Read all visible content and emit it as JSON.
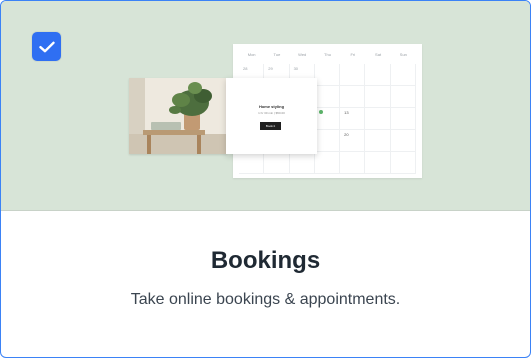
{
  "card": {
    "selected": true,
    "title": "Bookings",
    "description": "Take online bookings & appointments."
  },
  "illustration": {
    "weekdays": [
      "Mon",
      "Tue",
      "Wed",
      "Thu",
      "Fri",
      "Sat",
      "Sun"
    ],
    "days": [
      "28",
      "29",
      "30",
      "",
      "",
      "",
      "",
      "",
      "",
      "",
      "",
      "",
      "",
      "",
      "",
      "",
      "",
      "",
      "13",
      "",
      "",
      "",
      "",
      "",
      "",
      "20",
      "",
      "",
      "",
      "",
      "",
      "",
      "",
      "",
      ""
    ],
    "popup_title": "Home styling",
    "popup_detail": "1 hr 30 min | $50.00",
    "popup_button": "Book it"
  },
  "colors": {
    "accent": "#2f6ff2",
    "border": "#3b82f6",
    "hero_bg": "#d7e4d7"
  }
}
